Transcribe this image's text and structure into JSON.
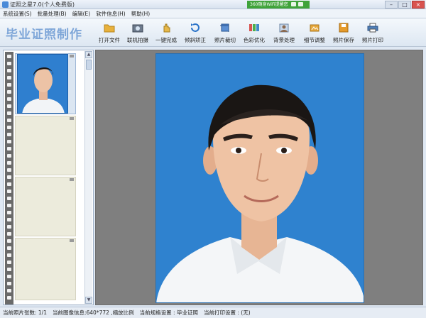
{
  "window": {
    "title": "证照之星7.0(个人免费版)",
    "notice": "360随身WiFi提醒您",
    "minimize": "–",
    "maximize": "□",
    "close": "×"
  },
  "menu": [
    "系统设置(S)",
    "批量处理(B)",
    "编辑(E)",
    "软件信息(H)",
    "帮助(H)"
  ],
  "brand": "毕业证照制作",
  "toolbar": [
    {
      "label": "打开文件",
      "icon": "folder-icon"
    },
    {
      "label": "联机拍摄",
      "icon": "camera-icon"
    },
    {
      "label": "一键完成",
      "icon": "hand-icon"
    },
    {
      "label": "倾斜矫正",
      "icon": "rotate-icon"
    },
    {
      "label": "照片裁切",
      "icon": "crop-icon"
    },
    {
      "label": "色彩优化",
      "icon": "palette-icon"
    },
    {
      "label": "背景处理",
      "icon": "background-icon"
    },
    {
      "label": "细节调整",
      "icon": "detail-icon"
    },
    {
      "label": "照片保存",
      "icon": "save-icon"
    },
    {
      "label": "照片打印",
      "icon": "printer-icon"
    }
  ],
  "status": {
    "count": "当前照片张数: 1/1",
    "image_info": "当前图像信息:640*772 ,缩放比例",
    "spec": "当前规格设置 : 毕业证照",
    "print": "当前打印设置 : (无)"
  },
  "colors": {
    "photo_background": "#2f82cf",
    "workspace": "#7f7f7f",
    "brand": "#7ea6d8"
  }
}
